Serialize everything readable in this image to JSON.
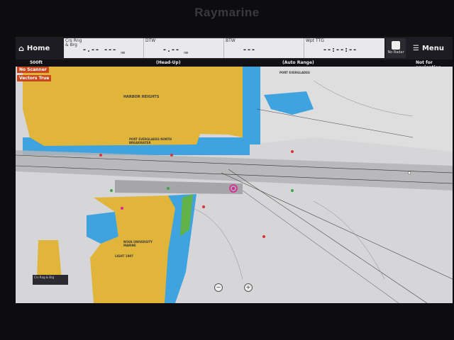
{
  "device": {
    "brand": "Raymarine"
  },
  "topbar": {
    "home_label": "Home",
    "menu_label": "Menu",
    "cells": [
      {
        "label": "Crs Rng\n& Brg",
        "value": "-.-- ---",
        "unit": "nm"
      },
      {
        "label": "DTW",
        "value": "-.--",
        "unit": "nm"
      },
      {
        "label": "BTW",
        "value": "---",
        "unit": ""
      },
      {
        "label": "Wpt TTG",
        "value": "--:--:--",
        "unit": ""
      }
    ],
    "radar_label": "No Radar"
  },
  "statusbar": {
    "scale": "500ft",
    "orientation": "(Head-Up)",
    "range_mode": "(Auto Range)",
    "nav_note": "Not for navigation"
  },
  "overlays": {
    "no_scanner": "No Scanner",
    "vectors_true": "Vectors True",
    "corner_box": "Crs Rng & Brg"
  },
  "map": {
    "place_names": [
      "HARBOR HEIGHTS",
      "PORT EVERGLADES",
      "LIGHT 1997",
      "PORT EVERGLADES NORTH BREAKWATER",
      "NOVA UNIVERSITY MARINE"
    ],
    "colors": {
      "land": "#e1b43a",
      "shallow": "#3aa0e0",
      "deep": "#dcdcdc",
      "channel": "#b4b4b6"
    }
  }
}
